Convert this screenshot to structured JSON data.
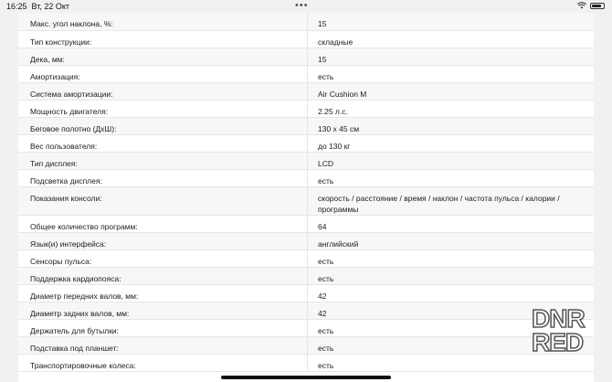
{
  "status_bar": {
    "time": "16:25",
    "date": "Вт, 22 Окт",
    "dots": "•••",
    "battery_level": 0.7
  },
  "specs": [
    {
      "key": "Макс. угол наклона, %:",
      "value": "15"
    },
    {
      "key": "Тип конструкции:",
      "value": "складные"
    },
    {
      "key": "Дека, мм:",
      "value": "15"
    },
    {
      "key": "Амортизация:",
      "value": "есть"
    },
    {
      "key": "Система амортизации:",
      "value": "Air Cushion M"
    },
    {
      "key": "Мощность двигателя:",
      "value": "2.25 л.с."
    },
    {
      "key": "Беговое полотно (ДхШ):",
      "value": "130 х 45 см"
    },
    {
      "key": "Вес пользователя:",
      "value": "до 130 кг"
    },
    {
      "key": "Тип дисплея:",
      "value": "LCD"
    },
    {
      "key": "Подсветка дисплея:",
      "value": "есть"
    },
    {
      "key": "Показания консоли:",
      "value": "скорость / расстояние / время / наклон / частота пульса / калории / программы"
    },
    {
      "key": "Общее количество программ:",
      "value": "64"
    },
    {
      "key": "Язык(и) интерфейса:",
      "value": "английский"
    },
    {
      "key": "Сенсоры пульса:",
      "value": "есть"
    },
    {
      "key": "Поддержка кардиопояса:",
      "value": "есть"
    },
    {
      "key": "Диаметр передних валов, мм:",
      "value": "42"
    },
    {
      "key": "Диаметр задних валов, мм:",
      "value": "42"
    },
    {
      "key": "Держатель для бутылки:",
      "value": "есть"
    },
    {
      "key": "Подставка под планшет:",
      "value": "есть"
    },
    {
      "key": "Транспортировочные колеса:",
      "value": "есть"
    }
  ],
  "watermark": {
    "line1": "DNR",
    "line2": "RED"
  }
}
